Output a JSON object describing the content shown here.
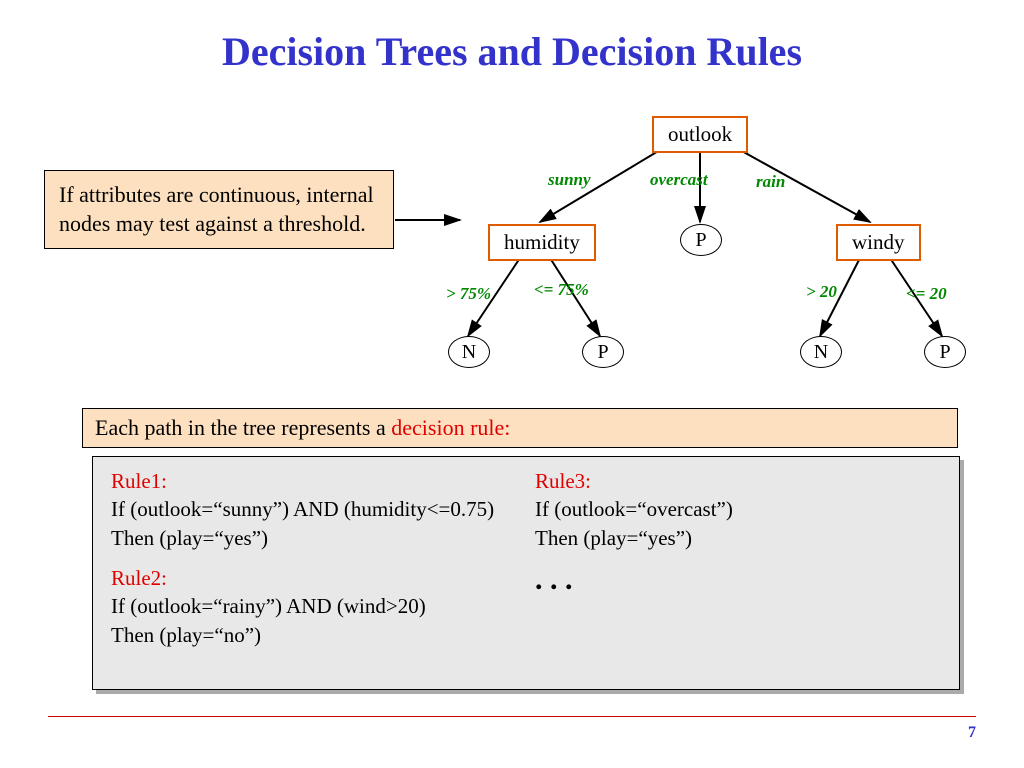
{
  "title": "Decision Trees and Decision Rules",
  "note": "If attributes are continuous, internal nodes may test against a threshold.",
  "tree": {
    "root": "outlook",
    "edges": {
      "sunny": "sunny",
      "overcast": "overcast",
      "rain": "rain",
      "h_gt": "> 75%",
      "h_le": "<= 75%",
      "w_gt": "> 20",
      "w_le": "<= 20"
    },
    "nodes": {
      "humidity": "humidity",
      "windy": "windy"
    },
    "leaves": {
      "P": "P",
      "N": "N"
    }
  },
  "caption": {
    "prefix": "Each path in the tree represents a ",
    "highlight": "decision rule:"
  },
  "rules": {
    "r1": {
      "head": "Rule1:",
      "cond": "If (outlook=“sunny”) AND (humidity<=0.75)",
      "then": "Then (play=“yes”)"
    },
    "r2": {
      "head": "Rule2:",
      "cond": "If (outlook=“rainy”) AND (wind>20)",
      "then": "Then (play=“no”)"
    },
    "r3": {
      "head": "Rule3:",
      "cond": "If (outlook=“overcast”)",
      "then": "Then (play=“yes”)"
    },
    "dots": ". . ."
  },
  "page": "7"
}
